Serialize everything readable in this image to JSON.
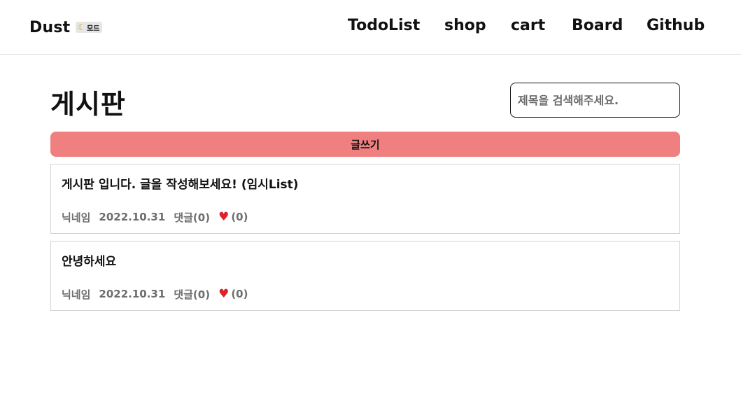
{
  "header": {
    "brand": "Dust",
    "mode_label": "모드",
    "nav": [
      "TodoList",
      "shop",
      "cart",
      "Board",
      "Github"
    ]
  },
  "page": {
    "title": "게시판",
    "search": {
      "placeholder": "제목을 검색해주세요.",
      "value": ""
    },
    "write_button": "글쓰기"
  },
  "posts": [
    {
      "title": "게시판 입니다. 글을 작성해보세요! (임시List)",
      "author": "닉네임",
      "date": "2022.10.31",
      "comments": "댓글(0)",
      "likes": "(0)"
    },
    {
      "title": "안녕하세요",
      "author": "닉네임",
      "date": "2022.10.31",
      "comments": "댓글(0)",
      "likes": "(0)"
    }
  ],
  "icons": {
    "mode_toggle": "moon-icon",
    "like": "heart-icon"
  },
  "colors": {
    "write_button_bg": "#f08080",
    "meta_text": "#6e6e6e",
    "heart": "#e0202a"
  }
}
